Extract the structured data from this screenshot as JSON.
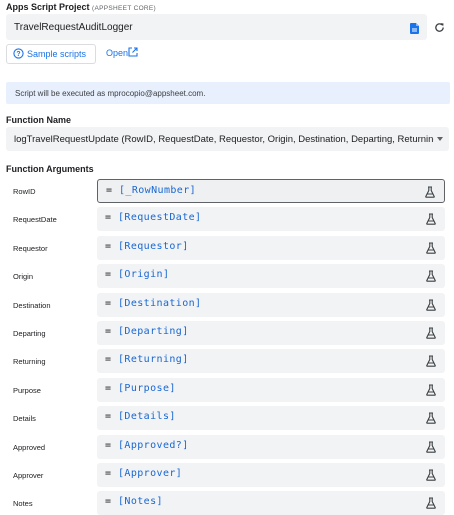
{
  "project": {
    "section_label": "Apps Script Project",
    "section_sublabel": "(APPSHEET CORE)",
    "file_name": "TravelRequestAuditLogger",
    "file_icon": "file-icon",
    "refresh_icon": "refresh-icon"
  },
  "links": {
    "sample_scripts_label": "Sample scripts",
    "open_label": "Open"
  },
  "info_banner": {
    "text": "Script will be executed as mprocopio@appsheet.com."
  },
  "function": {
    "section_label": "Function Name",
    "selected": "logTravelRequestUpdate (RowID, RequestDate, Requestor, Origin, Destination, Departing, Returning, Purpose, Details, Approved, Approver, Notes)"
  },
  "arguments": {
    "section_label": "Function Arguments",
    "items": [
      {
        "name": "RowID",
        "eq": "=",
        "expression": "[_RowNumber]"
      },
      {
        "name": "RequestDate",
        "eq": "=",
        "expression": "[RequestDate]"
      },
      {
        "name": "Requestor",
        "eq": "=",
        "expression": "[Requestor]"
      },
      {
        "name": "Origin",
        "eq": "=",
        "expression": "[Origin]"
      },
      {
        "name": "Destination",
        "eq": "=",
        "expression": "[Destination]"
      },
      {
        "name": "Departing",
        "eq": "=",
        "expression": "[Departing]"
      },
      {
        "name": "Returning",
        "eq": "=",
        "expression": "[Returning]"
      },
      {
        "name": "Purpose",
        "eq": "=",
        "expression": "[Purpose]"
      },
      {
        "name": "Details",
        "eq": "=",
        "expression": "[Details]"
      },
      {
        "name": "Approved",
        "eq": "=",
        "expression": "[Approved?]"
      },
      {
        "name": "Approver",
        "eq": "=",
        "expression": "[Approver]"
      },
      {
        "name": "Notes",
        "eq": "=",
        "expression": "[Notes]"
      }
    ]
  },
  "colors": {
    "accent": "#1a73e8",
    "expression": "#1967d2",
    "field_bg": "#f1f3f4",
    "banner_bg": "#e8f0fe"
  }
}
